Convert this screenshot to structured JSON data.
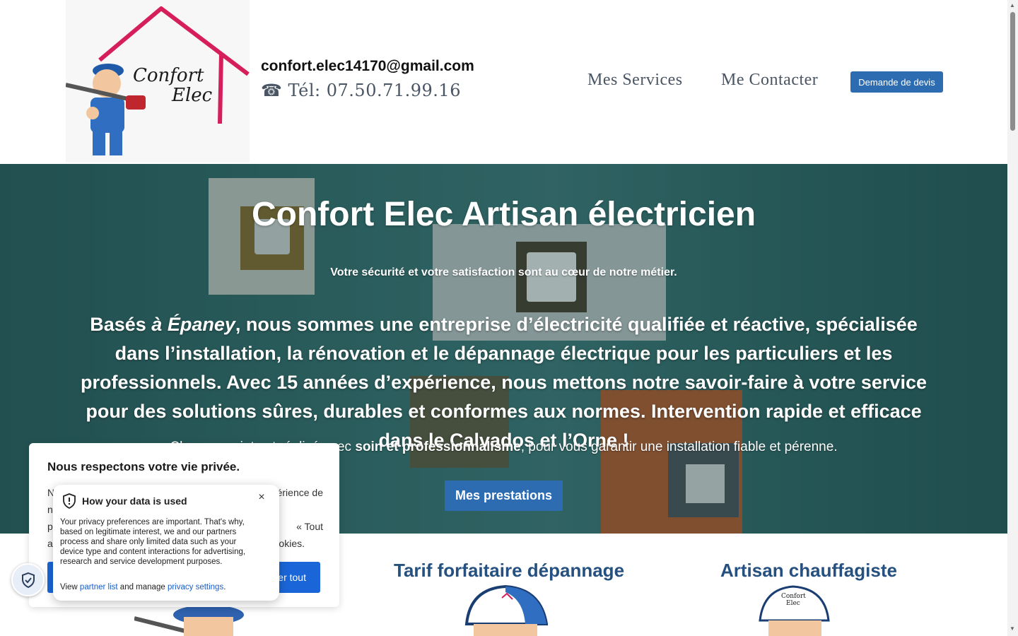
{
  "header": {
    "logo_text": "Confort Elec",
    "email": "confort.elec14170@gmail.com",
    "phone": "☎ Tél: 07.50.71.99.16",
    "nav": [
      "Mes Services",
      "Me Contacter"
    ],
    "quote_button": "Demande de devis"
  },
  "hero": {
    "title": "Confort Elec Artisan électricien",
    "subtitle": "Votre sécurité et votre satisfaction sont au cœur de notre métier.",
    "body_pre": "Basés ",
    "body_place": "à Épaney",
    "body_post": ", nous sommes une entreprise d’électricité qualifiée et réactive, spécialisée dans l’installation, la rénovation et le dépannage électrique pour les particuliers et les professionnels. Avec 15 années d’expérience, nous mettons notre savoir-faire à votre service pour des solutions sûres, durables et conformes aux normes. Intervention rapide et efficace dans le Calvados et l’Orne !",
    "small_pre": "Chaque projet est réalisé avec ",
    "small_bold": "soin et professionnalisme",
    "small_post": ", pour vous garantir une installation fiable et pérenne.",
    "button": "Mes prestations"
  },
  "cards": [
    {
      "title": "Tarif forfaitaire dépannage"
    },
    {
      "title": "Artisan chauffagiste"
    }
  ],
  "cookie": {
    "title": "Nous respectons votre vie privée.",
    "text_line1_pre": "N",
    "text_line1_post": "érience de",
    "text_line2": "n",
    "text_line3_pre": "p",
    "text_line3_post": "« Tout",
    "text_line4_pre": "a",
    "text_line4_post": "okies.",
    "accept_button": "er tout"
  },
  "popover": {
    "title": "How your data is used",
    "close": "×",
    "text": "Your privacy preferences are important. That's why, based on legitimate interest, we and our partners process and share only limited data such as your device type and content interactions for advertising, research and service development purposes.",
    "footer_pre": "View ",
    "partner_link": "partner list",
    "footer_mid": " and manage ",
    "settings_link": "privacy settings",
    "footer_post": "."
  },
  "colors": {
    "brand_blue": "#2e6cb1",
    "card_title": "#25507f",
    "hero_bg": "#356c6c",
    "cookie_blue": "#1a66d8"
  }
}
